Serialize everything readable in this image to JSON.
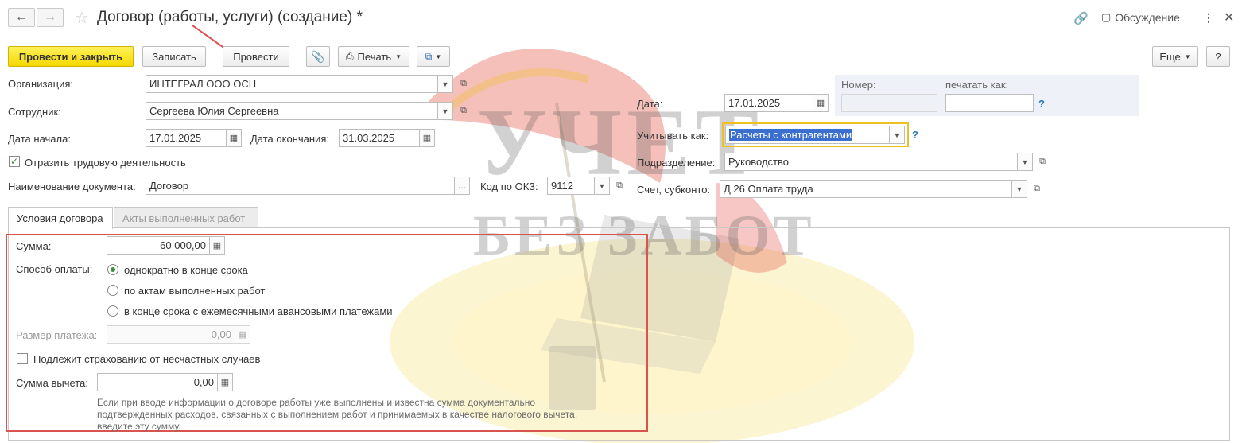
{
  "window": {
    "title": "Договор (работы, услуги) (создание) *",
    "discussion_label": "Обсуждение"
  },
  "toolbar": {
    "post_close_label": "Провести и закрыть",
    "save_label": "Записать",
    "post_label": "Провести",
    "print_label": "Печать",
    "more_label": "Еще",
    "help_label": "?"
  },
  "form": {
    "organization_label": "Организация:",
    "organization_value": "ИНТЕГРАЛ ООО ОСН",
    "employee_label": "Сотрудник:",
    "employee_value": "Сергеева Юлия Сергеевна",
    "start_date_label": "Дата начала:",
    "start_date_value": "17.01.2025",
    "end_date_label": "Дата окончания:",
    "end_date_value": "31.03.2025",
    "reflect_label": "Отразить трудовую деятельность",
    "reflect_checked": true,
    "doc_name_label": "Наименование документа:",
    "doc_name_value": "Договор",
    "okz_label": "Код по ОКЗ:",
    "okz_value": "9112",
    "number_label": "Номер:",
    "number_value": "",
    "print_as_label": "печатать как:",
    "print_as_value": "",
    "date_label": "Дата:",
    "date_value": "17.01.2025",
    "account_as_label": "Учитывать как:",
    "account_as_value": "Расчеты с контрагентами",
    "department_label": "Подразделение:",
    "department_value": "Руководство",
    "account_label": "Счет, субконто:",
    "account_value": "Д 26 Оплата труда"
  },
  "tabs": [
    {
      "label": "Условия договора",
      "active": true
    },
    {
      "label": "Акты выполненных работ",
      "active": false
    }
  ],
  "conditions": {
    "sum_label": "Сумма:",
    "sum_value": "60 000,00",
    "payment_method_label": "Способ оплаты:",
    "payment_options": [
      {
        "label": "однократно в конце срока",
        "selected": true
      },
      {
        "label": "по актам выполненных работ",
        "selected": false
      },
      {
        "label": "в конце срока с ежемесячными авансовыми платежами",
        "selected": false
      }
    ],
    "payment_size_label": "Размер платежа:",
    "payment_size_value": "0,00",
    "insurance_label": "Подлежит страхованию от несчастных случаев",
    "insurance_checked": false,
    "deduction_label": "Сумма вычета:",
    "deduction_value": "0,00",
    "hint_line1": "Если при вводе информации о договоре работы уже выполнены и известна сумма документально",
    "hint_line2": "подтвержденных расходов, связанных с выполнением работ и принимаемых в качестве налогового вычета,",
    "hint_line3": "введите эту сумму."
  },
  "watermark": {
    "line1": "УЧЕТ",
    "line2": "БЕЗ ЗАБОТ"
  },
  "colors": {
    "primary_button": "#f5d800",
    "highlight_border": "#d9534f",
    "selected_field_border": "#f0c020",
    "selection_bg": "#3a6fd0",
    "link": "#1f7ab8"
  }
}
